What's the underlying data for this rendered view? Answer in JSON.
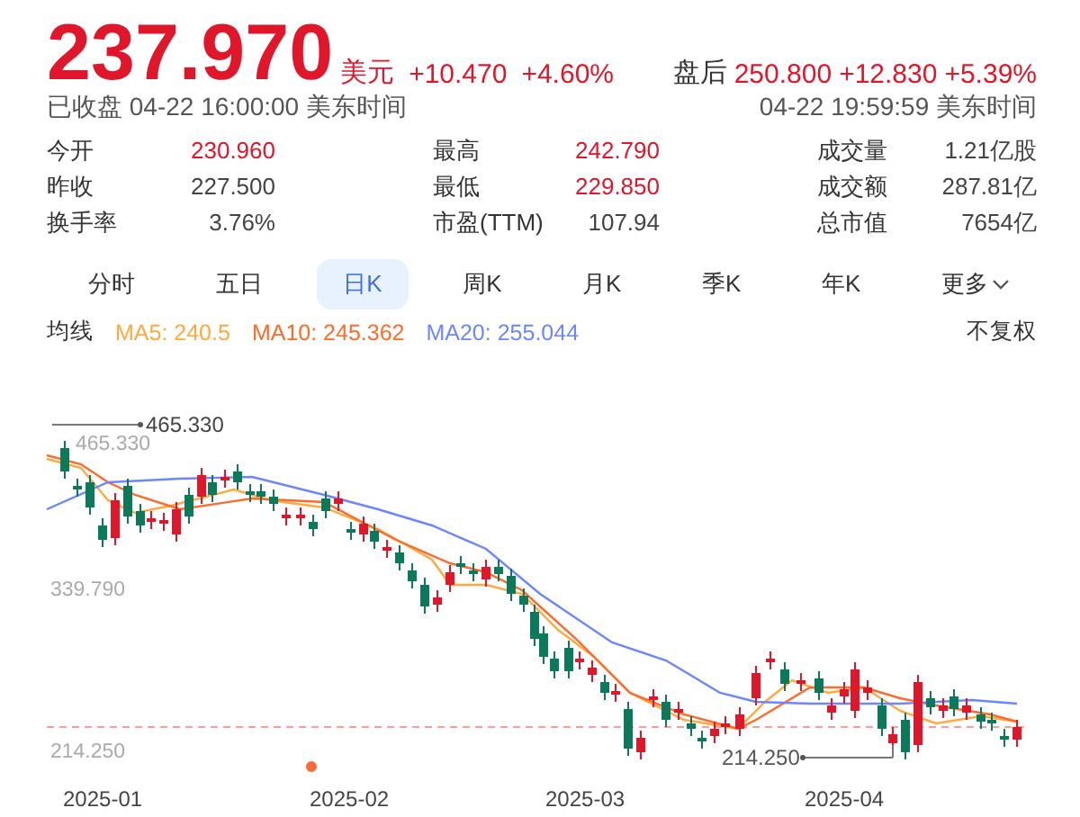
{
  "quote": {
    "price": "237.970",
    "currency": "美元",
    "change": "+10.470",
    "change_pct": "+4.60%",
    "status": "已收盘 04-22 16:00:00 美东时间",
    "after_hours": {
      "label": "盘后",
      "price": "250.800",
      "change": "+12.830",
      "change_pct": "+5.39%",
      "time": "04-22 19:59:59 美东时间"
    }
  },
  "stats": [
    {
      "label": "今开",
      "value": "230.960",
      "kind": "up"
    },
    {
      "label": "最高",
      "value": "242.790",
      "kind": "up"
    },
    {
      "label": "成交量",
      "value": "1.21亿股",
      "kind": "plain"
    },
    {
      "label": "昨收",
      "value": "227.500",
      "kind": "plain"
    },
    {
      "label": "最低",
      "value": "229.850",
      "kind": "up"
    },
    {
      "label": "成交额",
      "value": "287.81亿",
      "kind": "plain"
    },
    {
      "label": "换手率",
      "value": "3.76%",
      "kind": "plain"
    },
    {
      "label": "市盈(TTM)",
      "value": "107.94",
      "kind": "plain"
    },
    {
      "label": "总市值",
      "value": "7654亿",
      "kind": "plain"
    }
  ],
  "tabs": [
    {
      "label": "分时",
      "selected": false
    },
    {
      "label": "五日",
      "selected": false
    },
    {
      "label": "日K",
      "selected": true
    },
    {
      "label": "周K",
      "selected": false
    },
    {
      "label": "月K",
      "selected": false
    },
    {
      "label": "季K",
      "selected": false
    },
    {
      "label": "年K",
      "selected": false
    },
    {
      "label": "更多",
      "selected": false,
      "kind": "menu"
    }
  ],
  "ma_legend": {
    "label": "均线",
    "items": [
      {
        "text": "MA5: 240.5",
        "color": "#ffa940"
      },
      {
        "text": "MA10: 245.362",
        "color": "#ff6a2a"
      },
      {
        "text": "MA20: 255.044",
        "color": "#6b86ff"
      }
    ],
    "adjust": "不复权"
  },
  "chart": {
    "y_axis": [
      "465.330",
      "339.790",
      "214.250"
    ],
    "high_marker": "465.330",
    "low_marker": "214.250",
    "x_axis": [
      "2025-01",
      "2025-02",
      "2025-03",
      "2025-04"
    ]
  }
}
